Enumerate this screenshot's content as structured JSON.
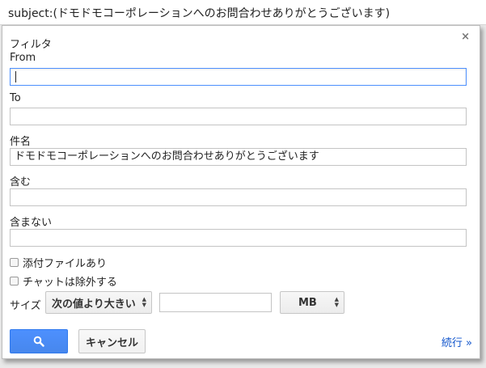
{
  "search_bar": {
    "query": "subject:(ドモドモコーポレーションへのお問合わせありがとうございます)"
  },
  "panel": {
    "close_glyph": "×",
    "title": "フィルタ",
    "from_label": "From",
    "from_value": "",
    "to_label": "To",
    "to_value": "",
    "subject_label": "件名",
    "subject_value": "ドモドモコーポレーションへのお問合わせありがとうございます",
    "has_words_label": "含む",
    "has_words_value": "",
    "doesnt_have_label": "含まない",
    "doesnt_have_value": "",
    "has_attachment_label": "添付ファイルあり",
    "exclude_chats_label": "チャットは除外する",
    "size_label": "サイズ",
    "size_operator": "次の値より大きい",
    "size_value": "",
    "size_unit": "MB",
    "cancel_label": "キャンセル",
    "more_label": "続行 »"
  },
  "colors": {
    "primary_button": "#4d90fe",
    "link": "#1155cc",
    "focus_border": "#4d90fe"
  },
  "icons": {
    "search_button": "search-icon",
    "close": "close-icon",
    "select_arrows": "updown-arrows-icon"
  }
}
